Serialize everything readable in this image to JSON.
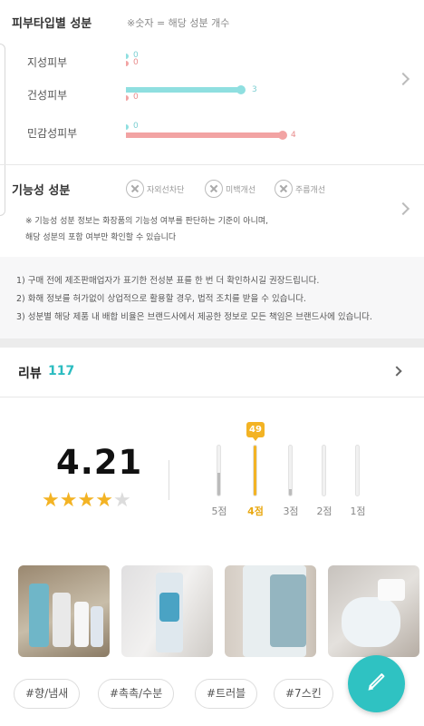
{
  "skin_type": {
    "title": "피부타입별 성분",
    "legend_note": "※숫자 = 해당 성분 개수",
    "rows": [
      {
        "label": "지성피부",
        "good": 0,
        "bad": 0
      },
      {
        "label": "건성피부",
        "good": 3,
        "bad": 0
      },
      {
        "label": "민감성피부",
        "good": 0,
        "bad": 4
      }
    ],
    "good_color": "#8fdfe0",
    "bad_color": "#f2a3a3",
    "chevron_icon": "chevron-right-icon"
  },
  "functional": {
    "title": "기능성 성분",
    "chips": [
      "자외선차단",
      "미백개선",
      "주름개선"
    ],
    "chip_icon": "x-circle-icon",
    "note_line1": "※ 기능성 성분 정보는 화장품의 기능성 여부를 판단하는 기준이 아니며,",
    "note_line2": "해당 성분의 포함 여부만 확인할 수 있습니다"
  },
  "notices": [
    "1) 구매 전에 제조판매업자가 표기한 전성분 표를 한 번 더 확인하시길 권장드립니다.",
    "2) 화해 정보를 허가없이 상업적으로 활용할 경우, 법적 조치를 받을 수 있습니다.",
    "3) 성분별 해당 제품 내 배합 비율은 브랜드사에서 제공한 정보로 모든 책임은 브랜드사에 있습니다."
  ],
  "review": {
    "title": "리뷰",
    "count": "117",
    "rating": "4.21",
    "stars_filled": 4,
    "stars_total": 5,
    "accent_color": "#f3b324",
    "distribution": [
      {
        "label": "5점",
        "fraction": 0.45,
        "active": false
      },
      {
        "label": "4점",
        "fraction": 1.0,
        "active": true,
        "badge": "49"
      },
      {
        "label": "3점",
        "fraction": 0.12,
        "active": false
      },
      {
        "label": "2점",
        "fraction": 0.0,
        "active": false
      },
      {
        "label": "1점",
        "fraction": 0.0,
        "active": false
      }
    ]
  },
  "tags": [
    "#향/냄새",
    "#촉촉/수분",
    "#트러블",
    "#7스킨"
  ],
  "fab_icon": "pencil-icon",
  "brand_color": "#2fc2c2"
}
